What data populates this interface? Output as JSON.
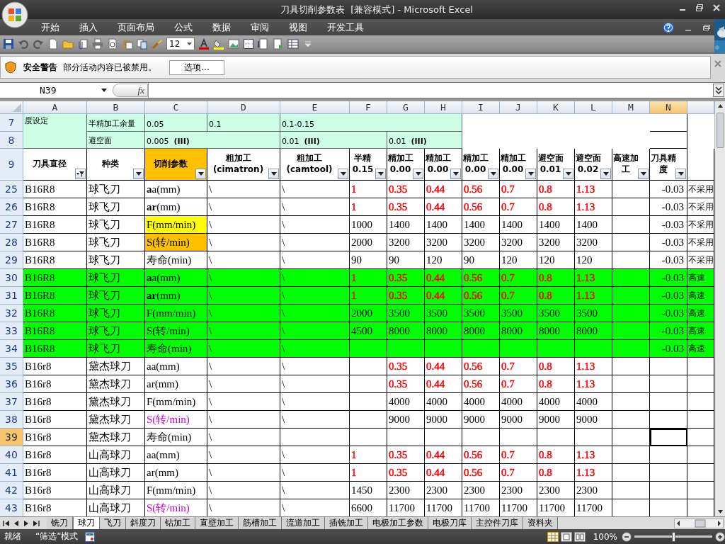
{
  "window": {
    "title": "刀具切削参数表  [兼容模式] - Microsoft Excel"
  },
  "ribbon": {
    "tabs": [
      {
        "label": "开始",
        "selected": false
      },
      {
        "label": "插入",
        "selected": false
      },
      {
        "label": "页面布局",
        "selected": false
      },
      {
        "label": "公式",
        "selected": false
      },
      {
        "label": "数据",
        "selected": false
      },
      {
        "label": "审阅",
        "selected": false
      },
      {
        "label": "视图",
        "selected": false
      },
      {
        "label": "开发工具",
        "selected": false
      }
    ]
  },
  "toolbar": {
    "font_size": "12"
  },
  "security_bar": {
    "title": "安全警告",
    "message": "部分活动内容已被禁用。",
    "button": "选项..."
  },
  "formula_bar": {
    "name_box": "N39",
    "function_label": "fx"
  },
  "sheet": {
    "columns": [
      {
        "label": "A",
        "selected": false
      },
      {
        "label": "B",
        "selected": false
      },
      {
        "label": "C",
        "selected": false
      },
      {
        "label": "D",
        "selected": false
      },
      {
        "label": "E",
        "selected": false
      },
      {
        "label": "F",
        "selected": false
      },
      {
        "label": "G",
        "selected": false
      },
      {
        "label": "H",
        "selected": false
      },
      {
        "label": "I",
        "selected": false
      },
      {
        "label": "J",
        "selected": false
      },
      {
        "label": "K",
        "selected": false
      },
      {
        "label": "L",
        "selected": false
      },
      {
        "label": "M",
        "selected": false
      },
      {
        "label": "N",
        "selected": true
      }
    ],
    "settings_rows": [
      {
        "number": "7",
        "cells": [
          "度设定",
          "半精加工余量",
          "0.05",
          "0.1",
          "0.1-0.15"
        ]
      },
      {
        "number": "8",
        "cells": [
          "避空面",
          "0.005  **(III)**",
          "0.01  **(III)**",
          "0.01  **(III)**"
        ]
      }
    ],
    "header_row": {
      "number": "9",
      "headers": [
        {
          "label": "刀具直径",
          "filtered": true
        },
        {
          "label": "种类",
          "filtered": false
        },
        {
          "label": "切削参数",
          "filtered": false,
          "color": "#ffc000"
        },
        {
          "label": "粗加工\n(cimatron)",
          "filtered": false
        },
        {
          "label": "粗加工(camtool)",
          "filtered": false
        },
        {
          "label": "半精\n0.15",
          "filtered": false
        },
        {
          "label": "精加工\n0.00",
          "filtered": false
        },
        {
          "label": "精加工\n0.00",
          "filtered": false
        },
        {
          "label": "精加工\n0.00",
          "filtered": false
        },
        {
          "label": "精加工\n0.00",
          "filtered": false
        },
        {
          "label": "避空面\n0.01",
          "filtered": false
        },
        {
          "label": "避空面\n0.02",
          "filtered": false
        },
        {
          "label": "高速加工",
          "filtered": false
        },
        {
          "label": "刀具精度",
          "filtered": false
        }
      ]
    },
    "rows": [
      {
        "number": "25",
        "selected": false,
        "tool": "B16R8",
        "type": "球飞刀",
        "param": {
          "text": "**a**a(mm)",
          "kind": "plain"
        },
        "cimatron": "\\",
        "camtool": "\\",
        "values": {
          "color": "#ff0000",
          "semi": "1",
          "items": [
            "0.35",
            "0.44",
            "0.56",
            "0.7",
            "0.8",
            "1.13"
          ]
        },
        "precision": "-0.03",
        "column_o": "不采用"
      },
      {
        "number": "26",
        "selected": false,
        "tool": "B16R8",
        "type": "球飞刀",
        "param": {
          "text": "**ar**(mm)",
          "kind": "plain"
        },
        "cimatron": "\\",
        "camtool": "\\",
        "values": {
          "color": "#ff0000",
          "semi": "1",
          "items": [
            "0.35",
            "0.44",
            "0.56",
            "0.7",
            "0.8",
            "1.13"
          ]
        },
        "precision": "-0.03",
        "column_o": "不采用"
      },
      {
        "number": "27",
        "selected": false,
        "tool": "B16R8",
        "type": "球飞刀",
        "param": {
          "text": "F(mm/min)",
          "kind": "fill",
          "color": "#ffff00"
        },
        "cimatron": "\\",
        "camtool": "\\",
        "values": {
          "semi": "1000",
          "items": [
            "1400",
            "1400",
            "1400",
            "1400",
            "1400",
            "1400"
          ]
        },
        "precision": "-0.03",
        "column_o": "不采用"
      },
      {
        "number": "28",
        "selected": false,
        "tool": "B16R8",
        "type": "球飞刀",
        "param": {
          "text": "S(转/min)",
          "kind": "fill",
          "color": "#ffc000"
        },
        "cimatron": "\\",
        "camtool": "\\",
        "values": {
          "semi": "2000",
          "items": [
            "3200",
            "3200",
            "3200",
            "3200",
            "3200",
            "3200"
          ]
        },
        "precision": "-0.03",
        "column_o": "不采用"
      },
      {
        "number": "29",
        "selected": false,
        "tool": "B16R8",
        "type": "球飞刀",
        "param": {
          "text": "寿命(min)",
          "kind": "plain"
        },
        "cimatron": "\\",
        "camtool": "\\",
        "values": {
          "semi": "90",
          "items": [
            "90",
            "120",
            "90",
            "120",
            "120",
            "120"
          ]
        },
        "precision": "-0.03",
        "column_o": "不采用"
      },
      {
        "number": "30",
        "selected": false,
        "color": "#00ff00",
        "tool": "B16R8",
        "type": "球飞刀",
        "param": {
          "text": "**a**a(mm)",
          "kind": "plain"
        },
        "cimatron": "\\",
        "camtool": "\\",
        "values": {
          "color": "#ff0000",
          "semi": "1",
          "items": [
            "0.35",
            "0.44",
            "0.56",
            "0.7",
            "0.8",
            "1.13"
          ]
        },
        "precision": "-0.03",
        "column_o": "高速"
      },
      {
        "number": "31",
        "selected": false,
        "color": "#00ff00",
        "tool": "B16R8",
        "type": "球飞刀",
        "param": {
          "text": "**ar**(mm)",
          "kind": "plain"
        },
        "cimatron": "\\",
        "camtool": "\\",
        "values": {
          "color": "#ff0000",
          "semi": "1",
          "items": [
            "0.35",
            "0.44",
            "0.56",
            "0.7",
            "0.8",
            "1.13"
          ]
        },
        "precision": "-0.03",
        "column_o": "高速"
      },
      {
        "number": "32",
        "selected": false,
        "color": "#00ff00",
        "tool": "B16R8",
        "type": "球飞刀",
        "param": {
          "text": "F(mm/min)",
          "kind": "plain"
        },
        "cimatron": "\\",
        "camtool": "\\",
        "values": {
          "semi": "2000",
          "items": [
            "3500",
            "3500",
            "3500",
            "3500",
            "3500",
            "3500"
          ]
        },
        "precision": "-0.03",
        "column_o": "高速"
      },
      {
        "number": "33",
        "selected": false,
        "color": "#00ff00",
        "tool": "B16R8",
        "type": "球飞刀",
        "param": {
          "text": "S(转/min)",
          "kind": "plain"
        },
        "cimatron": "\\",
        "camtool": "\\",
        "values": {
          "semi": "4500",
          "items": [
            "8000",
            "8000",
            "8000",
            "8000",
            "8000",
            "8000"
          ]
        },
        "precision": "-0.03",
        "column_o": "高速"
      },
      {
        "number": "34",
        "selected": false,
        "color": "#00ff00",
        "tool": "B16R8",
        "type": "球飞刀",
        "param": {
          "text": "寿命(min)",
          "kind": "plain"
        },
        "cimatron": "\\",
        "camtool": "\\",
        "precision": "-0.03",
        "column_o": "高速"
      },
      {
        "number": "35",
        "selected": false,
        "tool": "B16r8",
        "type": "黛杰球刀",
        "param": {
          "text": "aa(mm)",
          "kind": "plain"
        },
        "cimatron": "\\",
        "camtool": "\\",
        "values": {
          "color": "#ff0000",
          "items": [
            "0.35",
            "0.44",
            "0.56",
            "0.7",
            "0.8",
            "1.13"
          ]
        }
      },
      {
        "number": "36",
        "selected": false,
        "tool": "B16r8",
        "type": "黛杰球刀",
        "param": {
          "text": "ar(mm)",
          "kind": "plain"
        },
        "cimatron": "\\",
        "camtool": "\\",
        "values": {
          "color": "#ff0000",
          "items": [
            "0.35",
            "0.44",
            "0.56",
            "0.7",
            "0.8",
            "1.13"
          ]
        }
      },
      {
        "number": "37",
        "selected": false,
        "tool": "B16r8",
        "type": "黛杰球刀",
        "param": {
          "text": "F(mm/min)",
          "kind": "plain"
        },
        "cimatron": "\\",
        "camtool": "\\",
        "values": {
          "items": [
            "4000",
            "4000",
            "4000",
            "4000",
            "4000",
            "4000"
          ]
        }
      },
      {
        "number": "38",
        "selected": false,
        "tool": "B16r8",
        "type": "黛杰球刀",
        "param": {
          "text": "S(转/min)",
          "kind": "text",
          "color": "#cc00cc"
        },
        "cimatron": "\\",
        "camtool": "\\",
        "values": {
          "items": [
            "9000",
            "9000",
            "9000",
            "9000",
            "9000",
            "9000"
          ]
        }
      },
      {
        "number": "39",
        "selected": true,
        "tool": "B16r8",
        "type": "黛杰球刀",
        "param": {
          "text": "寿命(min)",
          "kind": "plain"
        },
        "cimatron": "\\"
      },
      {
        "number": "40",
        "selected": false,
        "tool": "B16r8",
        "type": "山高球刀",
        "param": {
          "text": "aa(mm)",
          "kind": "plain"
        },
        "cimatron": "\\",
        "camtool": "\\",
        "values": {
          "color": "#ff0000",
          "semi": "1",
          "items": [
            "0.35",
            "0.44",
            "0.56",
            "0.7",
            "0.8",
            "1.13"
          ]
        }
      },
      {
        "number": "41",
        "selected": false,
        "tool": "B16r8",
        "type": "山高球刀",
        "param": {
          "text": "ar(mm)",
          "kind": "plain"
        },
        "cimatron": "\\",
        "camtool": "\\",
        "values": {
          "color": "#ff0000",
          "semi": "1",
          "items": [
            "0.35",
            "0.44",
            "0.56",
            "0.7",
            "0.8",
            "1.13"
          ]
        }
      },
      {
        "number": "42",
        "selected": false,
        "tool": "B16r8",
        "type": "山高球刀",
        "param": {
          "text": "F(mm/min)",
          "kind": "plain"
        },
        "cimatron": "\\",
        "camtool": "\\",
        "values": {
          "semi": "1450",
          "items": [
            "2300",
            "2300",
            "2300",
            "2300",
            "2300",
            "2300"
          ]
        }
      },
      {
        "number": "43",
        "selected": false,
        "tool": "B16r8",
        "type": "山高球刀",
        "param": {
          "text": "S(转/min)",
          "kind": "text",
          "color": "#cc00cc"
        },
        "cimatron": "\\",
        "camtool": "\\",
        "values": {
          "semi": "6600",
          "items": [
            "11700",
            "11700",
            "11700",
            "11700",
            "11700",
            "11700"
          ]
        }
      }
    ]
  },
  "sheet_tabs": [
    {
      "label": "铣刀",
      "selected": false
    },
    {
      "label": "球刀",
      "selected": true
    },
    {
      "label": "飞刀",
      "selected": false
    },
    {
      "label": "斜度刀",
      "selected": false
    },
    {
      "label": "钻加工",
      "selected": false
    },
    {
      "label": "直壁加工",
      "selected": false
    },
    {
      "label": "筋槽加工",
      "selected": false
    },
    {
      "label": "流道加工",
      "selected": false
    },
    {
      "label": "插铣加工",
      "selected": false
    },
    {
      "label": "电极加工参数",
      "selected": false
    },
    {
      "label": "电极刀库",
      "selected": false
    },
    {
      "label": "主控件刀库",
      "selected": false
    },
    {
      "label": "资料夹",
      "selected": false
    }
  ],
  "status_bar": {
    "status": "就绪",
    "mode": "“筛选”模式",
    "zoom": {
      "label": "100%",
      "level": 0.5
    }
  }
}
